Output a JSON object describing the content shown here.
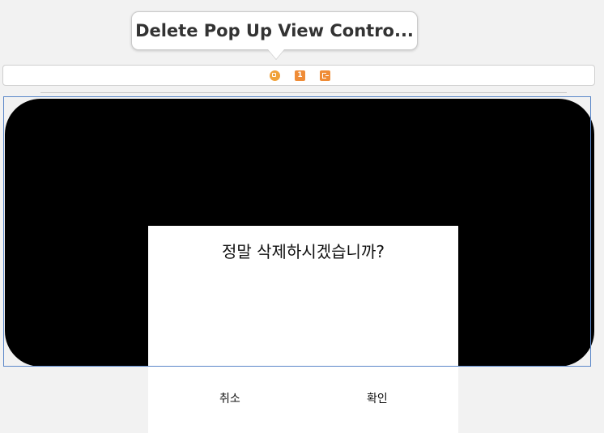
{
  "tooltip": {
    "text": "Delete Pop Up View Contro..."
  },
  "dock": {
    "icons": [
      {
        "name": "view-controller-icon"
      },
      {
        "name": "first-responder-icon",
        "label": "1"
      },
      {
        "name": "exit-icon"
      }
    ]
  },
  "popup": {
    "title": "정말 삭제하시겠습니까?",
    "cancel_label": "취소",
    "confirm_label": "확인"
  },
  "colors": {
    "canvas_bg": "#f2f2f2",
    "device_frame": "#000000",
    "popup_bg": "#ffffff",
    "selection_border": "#5b87c9",
    "dock_icon": "#ef8c37"
  }
}
